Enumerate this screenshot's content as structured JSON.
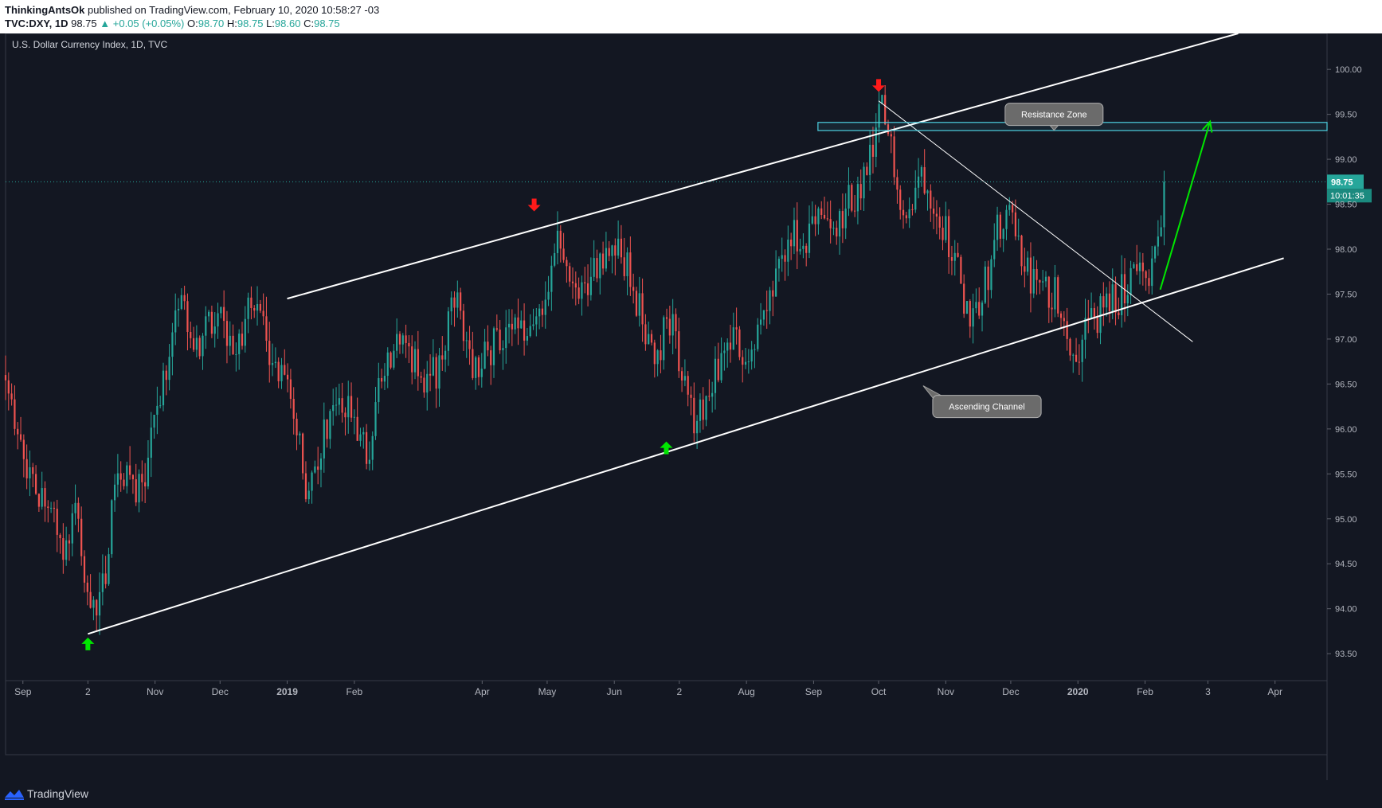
{
  "header": {
    "author": "ThinkingAntsOk",
    "published_text": " published on TradingView.com, February 10, 2020 10:58:27 -03",
    "symbol": "TVC:DXY, 1D",
    "last": "98.75",
    "change": "▲ +0.05 (+0.05%)",
    "o_label": "O:",
    "o_value": "98.70",
    "h_label": "H:",
    "h_value": "98.75",
    "l_label": "L:",
    "l_value": "98.60",
    "c_label": "C:",
    "c_value": "98.75"
  },
  "footer": {
    "brand": "TradingView"
  },
  "colors": {
    "background": "#131722",
    "up": "#26a69a",
    "down": "#ef5350",
    "resistance": "#4dd0e1",
    "projection": "#00e600",
    "marker_up": "#00e600",
    "marker_down": "#ff1a1a"
  },
  "chart_data": {
    "type": "candlestick",
    "title": "U.S. Dollar Currency Index, 1D, TVC",
    "ylim": [
      93.2,
      100.4
    ],
    "xlim": [
      "2018-08-24",
      "2020-04-25"
    ],
    "y_ticks": [
      "93.50",
      "94.00",
      "94.50",
      "95.00",
      "95.50",
      "96.00",
      "96.50",
      "97.00",
      "97.50",
      "98.00",
      "98.50",
      "99.00",
      "99.50",
      "100.00"
    ],
    "x_ticks": [
      {
        "label": "Sep",
        "date": "2018-09-01",
        "bold": false
      },
      {
        "label": "2",
        "date": "2018-10-01",
        "bold": false
      },
      {
        "label": "Nov",
        "date": "2018-11-01",
        "bold": false
      },
      {
        "label": "Dec",
        "date": "2018-12-01",
        "bold": false
      },
      {
        "label": "2019",
        "date": "2019-01-01",
        "bold": true
      },
      {
        "label": "Feb",
        "date": "2019-02-01",
        "bold": false
      },
      {
        "label": "Apr",
        "date": "2019-04-01",
        "bold": false
      },
      {
        "label": "May",
        "date": "2019-05-01",
        "bold": false
      },
      {
        "label": "Jun",
        "date": "2019-06-01",
        "bold": false
      },
      {
        "label": "2",
        "date": "2019-07-01",
        "bold": false
      },
      {
        "label": "Aug",
        "date": "2019-08-01",
        "bold": false
      },
      {
        "label": "Sep",
        "date": "2019-09-01",
        "bold": false
      },
      {
        "label": "Oct",
        "date": "2019-10-01",
        "bold": false
      },
      {
        "label": "Nov",
        "date": "2019-11-01",
        "bold": false
      },
      {
        "label": "Dec",
        "date": "2019-12-01",
        "bold": false
      },
      {
        "label": "2020",
        "date": "2020-01-01",
        "bold": true
      },
      {
        "label": "Feb",
        "date": "2020-02-01",
        "bold": false
      },
      {
        "label": "3",
        "date": "2020-03-01",
        "bold": false
      },
      {
        "label": "Apr",
        "date": "2020-04-01",
        "bold": false
      }
    ],
    "price_path": [
      [
        "2018-08-24",
        96.6
      ],
      [
        "2018-09-05",
        95.4
      ],
      [
        "2018-09-20",
        94.7
      ],
      [
        "2018-09-25",
        95.0
      ],
      [
        "2018-10-03",
        93.95
      ],
      [
        "2018-10-09",
        94.4
      ],
      [
        "2018-10-15",
        95.6
      ],
      [
        "2018-10-25",
        95.3
      ],
      [
        "2018-11-02",
        96.2
      ],
      [
        "2018-11-12",
        97.5
      ],
      [
        "2018-11-20",
        96.8
      ],
      [
        "2018-11-28",
        97.3
      ],
      [
        "2018-12-10",
        96.9
      ],
      [
        "2018-12-17",
        97.5
      ],
      [
        "2018-12-24",
        96.7
      ],
      [
        "2019-01-02",
        96.5
      ],
      [
        "2019-01-10",
        95.3
      ],
      [
        "2019-01-20",
        96.1
      ],
      [
        "2019-01-30",
        96.2
      ],
      [
        "2019-02-07",
        95.7
      ],
      [
        "2019-02-15",
        96.8
      ],
      [
        "2019-02-22",
        97.0
      ],
      [
        "2019-03-05",
        96.5
      ],
      [
        "2019-03-12",
        96.7
      ],
      [
        "2019-03-20",
        97.5
      ],
      [
        "2019-03-28",
        96.6
      ],
      [
        "2019-04-05",
        96.9
      ],
      [
        "2019-04-15",
        97.1
      ],
      [
        "2019-04-22",
        97.0
      ],
      [
        "2019-04-30",
        97.5
      ],
      [
        "2019-05-06",
        98.2
      ],
      [
        "2019-05-14",
        97.5
      ],
      [
        "2019-05-22",
        97.7
      ],
      [
        "2019-05-31",
        98.0
      ],
      [
        "2019-06-07",
        97.9
      ],
      [
        "2019-06-14",
        97.2
      ],
      [
        "2019-06-20",
        96.8
      ],
      [
        "2019-06-28",
        97.3
      ],
      [
        "2019-07-05",
        96.2
      ],
      [
        "2019-07-10",
        96.1
      ],
      [
        "2019-07-17",
        96.6
      ],
      [
        "2019-07-25",
        97.0
      ],
      [
        "2019-08-01",
        96.8
      ],
      [
        "2019-08-07",
        97.1
      ],
      [
        "2019-08-15",
        97.6
      ],
      [
        "2019-08-22",
        98.2
      ],
      [
        "2019-08-27",
        97.8
      ],
      [
        "2019-09-03",
        98.5
      ],
      [
        "2019-09-10",
        98.1
      ],
      [
        "2019-09-17",
        98.5
      ],
      [
        "2019-09-24",
        98.7
      ],
      [
        "2019-09-30",
        99.2
      ],
      [
        "2019-10-02",
        99.6
      ],
      [
        "2019-10-08",
        99.0
      ],
      [
        "2019-10-14",
        98.3
      ],
      [
        "2019-10-21",
        98.9
      ],
      [
        "2019-10-28",
        98.5
      ],
      [
        "2019-11-04",
        98.0
      ],
      [
        "2019-11-11",
        97.3
      ],
      [
        "2019-11-18",
        97.5
      ],
      [
        "2019-11-25",
        98.2
      ],
      [
        "2019-12-02",
        98.3
      ],
      [
        "2019-12-09",
        97.7
      ],
      [
        "2019-12-16",
        97.5
      ],
      [
        "2019-12-23",
        97.5
      ],
      [
        "2019-12-30",
        96.8
      ],
      [
        "2020-01-06",
        97.2
      ],
      [
        "2020-01-13",
        97.3
      ],
      [
        "2020-01-21",
        97.5
      ],
      [
        "2020-01-28",
        97.9
      ],
      [
        "2020-02-03",
        97.5
      ],
      [
        "2020-02-07",
        98.2
      ],
      [
        "2020-02-10",
        98.75
      ]
    ],
    "candle_spacing_days": 1.4,
    "last_price": {
      "value": 98.75,
      "label": "98.75",
      "countdown": "10:01:35"
    },
    "annotations": {
      "channel_upper": [
        [
          "2019-01-01",
          97.45
        ],
        [
          "2020-03-15",
          100.4
        ]
      ],
      "channel_lower": [
        [
          "2018-10-01",
          93.72
        ],
        [
          "2020-04-05",
          97.9
        ]
      ],
      "trend_line": [
        [
          "2019-10-01",
          99.65
        ],
        [
          "2020-02-23",
          96.97
        ]
      ],
      "resistance_zone": {
        "from": "2019-09-03",
        "y_low": 99.32,
        "y_high": 99.41
      },
      "projection": [
        [
          "2020-02-08",
          97.55
        ],
        [
          "2020-03-02",
          99.42
        ]
      ],
      "callouts": [
        {
          "text": "Resistance Zone",
          "at": [
            "2019-12-21",
            99.5
          ],
          "pointer": "down"
        },
        {
          "text": "Ascending Channel",
          "at": [
            "2019-11-20",
            96.25
          ],
          "pointer": "up-left"
        }
      ],
      "markers": [
        {
          "type": "up",
          "at": [
            "2018-10-01",
            93.6
          ]
        },
        {
          "type": "down",
          "at": [
            "2019-04-25",
            98.5
          ]
        },
        {
          "type": "up",
          "at": [
            "2019-06-25",
            95.78
          ]
        },
        {
          "type": "down",
          "at": [
            "2019-10-01",
            99.83
          ]
        }
      ]
    }
  }
}
